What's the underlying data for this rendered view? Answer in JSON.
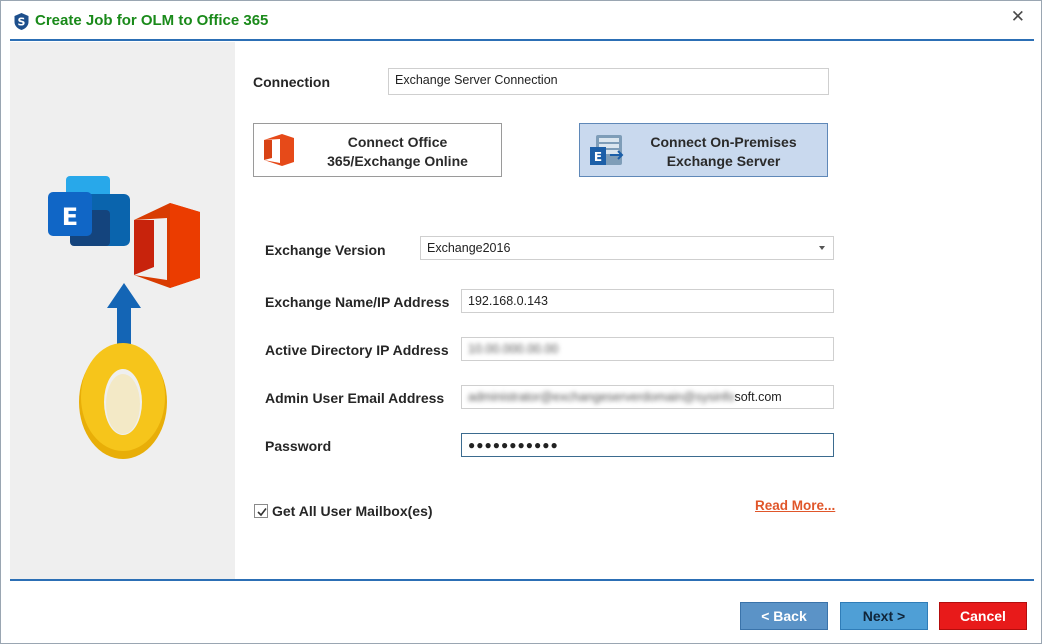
{
  "window": {
    "title": "Create Job for OLM to Office 365",
    "close_glyph": "✕",
    "app_icon": "sysinfo-s-icon"
  },
  "sidebar": {
    "icons": [
      "exchange-icon",
      "office-icon",
      "arrow-up-icon",
      "outlook-mac-icon"
    ]
  },
  "connection": {
    "label": "Connection",
    "value": "Exchange Server Connection"
  },
  "connect_options": [
    {
      "line1": "Connect Office",
      "line2": "365/Exchange Online",
      "icon": "office-365-icon",
      "selected": false
    },
    {
      "line1": "Connect On-Premises",
      "line2": "Exchange Server",
      "icon": "exchange-server-icon",
      "selected": true
    }
  ],
  "form": {
    "exchange_version": {
      "label": "Exchange Version",
      "value": "Exchange2016"
    },
    "exchange_name": {
      "label": "Exchange Name/IP Address",
      "value": "192.168.0.143"
    },
    "active_directory": {
      "label": "Active Directory IP Address",
      "value": "10.00.000.00.00"
    },
    "admin_email": {
      "label": "Admin User Email Address",
      "blurred_prefix": "administrator@exchangeserverdomain@sysinfo",
      "visible_suffix": "soft.com"
    },
    "password": {
      "label": "Password",
      "masked": "●●●●●●●●●●●"
    }
  },
  "options": {
    "get_all_mailboxes": {
      "label": "Get All User Mailbox(es)",
      "checked": true
    },
    "read_more": "Read More..."
  },
  "footer": {
    "back": "< Back",
    "next": "Next >",
    "cancel": "Cancel"
  },
  "colors": {
    "title_green": "#1a8a1a",
    "rule_blue": "#2c6fb5",
    "selected_button": "#c9d9ee",
    "cancel_red": "#e81a1a",
    "link_orange": "#e0562a"
  }
}
